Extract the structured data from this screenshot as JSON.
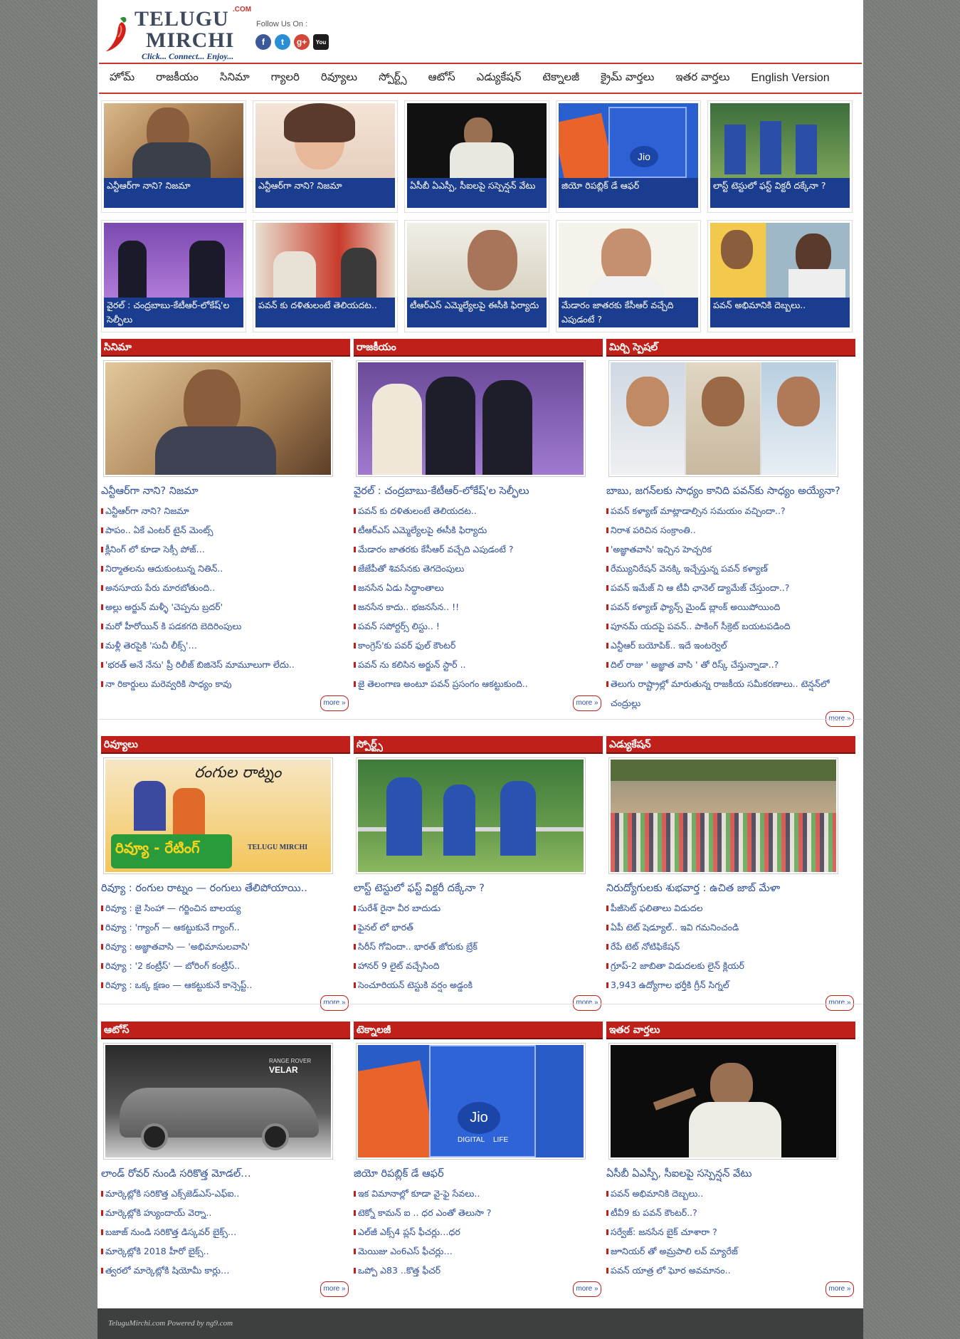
{
  "site": {
    "logo_line1": "TELUGU",
    "logo_line2": "MIRCHI",
    "logo_com": ".COM",
    "tagline": "Click... Connect... Enjoy...",
    "follow_label": "Follow Us On :"
  },
  "nav": [
    "హోమ్",
    "రాజకీయం",
    "సినిమా",
    "గ్యాలరి",
    "రివ్యూలు",
    "స్పోర్ట్స్",
    "ఆటోస్",
    "ఎడ్యుకేషన్",
    "టెక్నాలజీ",
    "క్రైమ్ వార్తలు",
    "ఇతర వార్తలు",
    "English Version"
  ],
  "top_stories": [
    "ఎన్టీఆర్‌గా నాని? నిజమా",
    "ఎన్టీఆర్‌గా నాని? నిజమా",
    "ఏసీబీ ఏఎస్పీ, సీఐలపై సస్పెన్షన్ వేటు",
    "జియో రిపబ్లిక్ డే ఆఫర్",
    "లాస్ట్ టెస్టులో ఫస్ట్ విక్టరీ దక్కేనా ?",
    "వైరల్ : చంద్రబాబు-కేటీఆర్-లోకేష్‌'ల సెల్ఫీలు",
    "పవన్ కు దళితులంటే తెలియదట..",
    "టీఆర్ఎస్ ఎమ్మెల్యేలపై ఈసీకి ఫిర్యాదు",
    "మేడారం జాతరకు కేసీఆర్ వచ్చేది ఎపుడంటే ?",
    "పవన్ అభిమానికి దెబ్బలు.."
  ],
  "sections": [
    {
      "title": "సినిమా",
      "headline": "ఎన్టీఆర్‌గా నాని? నిజమా",
      "items": [
        "ఎన్టీఆర్‌గా నాని? నిజమా",
        "పాపం.. ఏకే ఎంటర్ టైన్ మెంట్స్",
        "క్లీనింగ్ లో కూడా సెక్సీ పోజ్…",
        "నిర్మాతలను ఆదుకుంటున్న నితిన్..",
        "అనసూయ పేరు మారబోతుంది..",
        "అల్లు అర్జున్ మళ్ళీ 'చెప్పను బ్రదర్'",
        "మరో హీరోయిన్ కి పడకగది బెదిరింపులు",
        "మళ్లీ తెరపైకి 'సుచీ లీక్స్'…",
        "'భరత్ అనే నేను' ప్రీ రిలీజ్ బిజినెస్ మామూలుగా లేదు..",
        "నా రికార్డులు మరెవ్వరికి సాధ్యం కావు"
      ],
      "more": "more »"
    },
    {
      "title": "రాజకీయం",
      "headline": "వైరల్ : చంద్రబాబు-కేటీఆర్-లోకేష్‌'ల సెల్ఫీలు",
      "items": [
        "పవన్ కు దళితులంటే తెలియదట..",
        "టీఆర్ఎస్ ఎమ్మెల్యేలపై ఈసీకి ఫిర్యాదు",
        "మేడారం జాతరకు కేసీఆర్ వచ్చేది ఎపుడంటే ?",
        "జేజేపీతో శివసేనకు తెగదెంపులు",
        "జనసేన ఏడు సిద్ధాంతాలు",
        "జనసేన కాదు.. భజనసేన.. !!",
        "పవన్ సపోర్టర్స్ లిస్టు.. !",
        "కాంగ్రెస్'కు పవర్ ఫుల్ కౌంటర్",
        "పవన్ ను కలిసిన అర్జున్ స్టార్ ..",
        "జై తెలంగాణ అంటూ పవన్ ప్రసంగం ఆకట్టుకుంది.."
      ],
      "more": "more »"
    },
    {
      "title": "మిర్చి స్పెషల్",
      "headline": "బాబు, జగన్‌లకు సాధ్యం కానిది పవన్‌కు సాధ్యం అయ్యేనా?",
      "items": [
        "పవన్ కళ్యాణ్ మాట్లాడాల్సిన సమయం వచ్చిందా..?",
        "నిరాశ పరిచిన సంక్రాంతి..",
        "'అజ్ఞాతవాసి' ఇచ్చిన హెచ్చరిక",
        "రేమ్యునిరేషన్ వెనక్కి ఇచ్చేస్తున్న పవన్ కళ్యాణ్",
        "పవన్ ఇమేజ్ ని ఆ టీవీ ఛానెల్ డ్యామేజ్ చేస్తుందా..?",
        "పవన్ కళ్యాణ్ ఫ్యాన్స్ మైండ్ బ్లాంక్ అయిపోయింది",
        "పూనమ్ యదపై పవన్.. పాకింగ్ సీక్రెట్ బయటపడింది",
        "ఎన్టీఆర్ బయోపిక్.. ఇదే ఇంటర్వెల్",
        "దిల్ రాజు ' అజ్ఞాత వాసి ' తో రిస్క్ చేస్తున్నాడా..?",
        "తెలుగు రాష్ట్రాల్లో మారుతున్న రాజకీయ సమీకరణాలు.. టెన్షన్‌లో చంద్రుల్లు"
      ],
      "more": "more »"
    },
    {
      "title": "రివ్యూలు",
      "headline": "రివ్యూ : రంగుల రాట్నం — రంగులు తేలిపోయాయి..",
      "items": [
        "రివ్యూ : జై సింహా — గర్జించిన బాలయ్య",
        "రివ్యూ : 'గ్యాంగ్ — ఆకట్టుకునే గ్యాంగ్..",
        "రివ్యూ : అజ్ఞాతవాసి — 'అభిమానులవాసి'",
        "రివ్యూ : '2 కంట్రీస్' — బోరింగ్ కంట్రీస్..",
        "రివ్యూ : ఒక్క క్షణం — ఆకట్టుకునే కాన్సెప్ట్.."
      ],
      "more": "more »"
    },
    {
      "title": "స్పోర్ట్స్",
      "headline": "లాస్ట్ టెస్టులో ఫస్ట్ విక్టరీ దక్కేనా ?",
      "items": [
        "సురేశ్ రైనా వీర బాదుడు",
        "ఫైనల్ లో భారత్",
        "సిరీస్ గోవిందా.. భారత్ జోరుకు బ్రేక్",
        "హానర్ 9 లైట్ వచ్చేసింది",
        "సెంచూరియన్ టెస్టుకి వర్షం అడ్డంకి"
      ],
      "more": "more »"
    },
    {
      "title": "ఎడ్యుకేషన్",
      "headline": "నిరుద్యోగులకు శుభవార్త : ఉచిత జాబ్ మేళా",
      "items": [
        "పీజీసెట్ ఫలితాలు విడుదల",
        "ఏపీ టెట్ షెడ్యూల్.. ఇవి గమనించండి",
        "రేపే టెట్ నోటిఫికేషన్",
        "గ్రూప్-2 జాబితా విడుదలకు లైన్ క్లియర్",
        "3,943 ఉద్యోగాల భర్తీకి గ్రీన్ సిగ్నల్"
      ],
      "more": "more »"
    },
    {
      "title": "ఆటోస్",
      "headline": "లాండ్ రోవర్ నుండి సరికొత్త మోడల్…",
      "items": [
        "మార్కెట్లోకి సరికొత్త ఎక్స్‌జెడ్‌ఎస్-ఎఫ్ఐ..",
        "మార్కెట్లోకి హ్యుందాయ్ వెర్నా..",
        "బజాజ్ నుండి సరికొత్త డిస్కవర్ బైక్స్…",
        "మార్కెట్లోకి 2018 హీరో బైక్స్..",
        "త్వరలో మార్కెట్లోకి షియోమీ కార్లు…"
      ],
      "more": "more »"
    },
    {
      "title": "టెక్నాలజీ",
      "headline": "జియో రిపబ్లిక్ డే ఆఫర్",
      "items": [
        "ఇక విమానాల్లో కూడా వై-ఫై సేవలు..",
        "టెక్నో కామన్ ఐ .. ధర ఎంతో తెలుసా ?",
        "ఎల్‌జీ ఎక్స్4 ప్లస్ ఫీచర్లు…ధర",
        "మెయిజు ఎం6ఎస్ ఫీచర్లు…",
        "ఒప్పో ఎ83 ..కొత్త ఫీచర్"
      ],
      "more": "more »"
    },
    {
      "title": "ఇతర వార్తలు",
      "headline": "ఏసీబీ ఏఎస్పీ, సీఐలపై సస్పెన్షన్ వేటు",
      "items": [
        "పవన్ అభిమానికి దెబ్బలు..",
        "టీవీ9 కు పవన్ కౌంటర్..?",
        "సర్వేజ్: జనసేన బైక్ చూశారా ?",
        "జూనియర్ తో అమ్రపాలి లవ్ మ్యారేజ్",
        "పవన్ యాత్ర లో ఘోర అవమానం.."
      ],
      "more": "more »"
    }
  ],
  "review_image_text": {
    "script": "రంగుల రాట్నం",
    "banner": "రివ్యూ - రేటింగ్",
    "brand": "TELUGU MIRCHI"
  },
  "auto_image_text": {
    "brand": "RANGE ROVER",
    "model": "VELAR"
  },
  "tech_image_text": {
    "jio": "Jio",
    "digital": "DIGITAL",
    "life": "LIFE"
  },
  "footer": "TeluguMirchi.com Powered by ng9.com"
}
